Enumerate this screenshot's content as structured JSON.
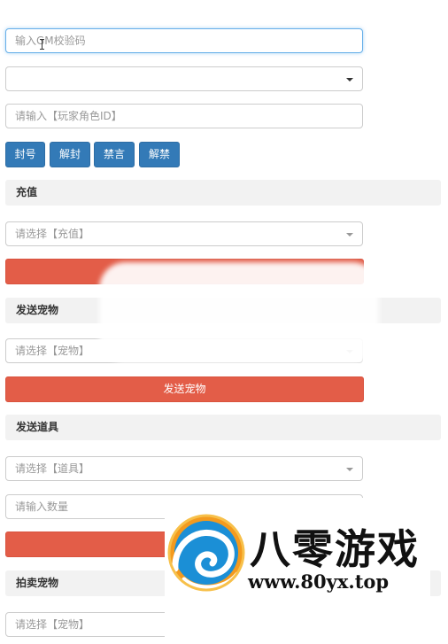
{
  "form": {
    "gm_code_placeholder": "输入GM校验码",
    "role_id_placeholder": "请输入【玩家角色ID】"
  },
  "actions": {
    "ban": "封号",
    "unban": "解封",
    "mute": "禁言",
    "unmute": "解禁"
  },
  "recharge": {
    "title": "充值",
    "select_placeholder": "请选择【充值】"
  },
  "send_pet": {
    "title": "发送宠物",
    "select_placeholder": "请选择【宠物】",
    "button": "发送宠物"
  },
  "send_item": {
    "title": "发送道具",
    "select_placeholder": "请选择【道具】",
    "quantity_placeholder": "请输入数量"
  },
  "auction_pet": {
    "title": "拍卖宠物",
    "select_placeholder": "请选择【宠物】"
  },
  "watermark": {
    "name": "八零游戏",
    "url": "www.80yx.top"
  },
  "colors": {
    "primary_button": "#337ab7",
    "danger_button": "#e35d48",
    "section_bg": "#f2f2f2",
    "focus_border": "#66afe9"
  }
}
